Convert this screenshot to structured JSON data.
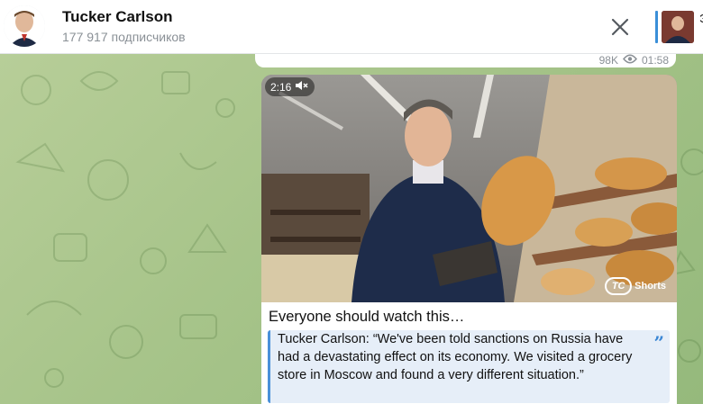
{
  "header": {
    "title": "Tucker Carlson",
    "subscribers": "177 917 подписчиков",
    "close_icon": "close-icon",
    "side_preview_text": "Э",
    "accent_color": "#3a8fd8"
  },
  "previous_message": {
    "views": "98K",
    "time": "01:58"
  },
  "message": {
    "video_duration": "2:16",
    "muted_icon": "muted-speaker-icon",
    "watermark_mark": "TC",
    "watermark_label": "Shorts",
    "caption": "Everyone should watch this…",
    "quote": "Tucker Carlson: “We've been told sanctions on Russia have had a devastating effect on its economy. We visited a grocery store in Moscow and found a very different situation.”",
    "quote_color": "#4a90d9"
  }
}
